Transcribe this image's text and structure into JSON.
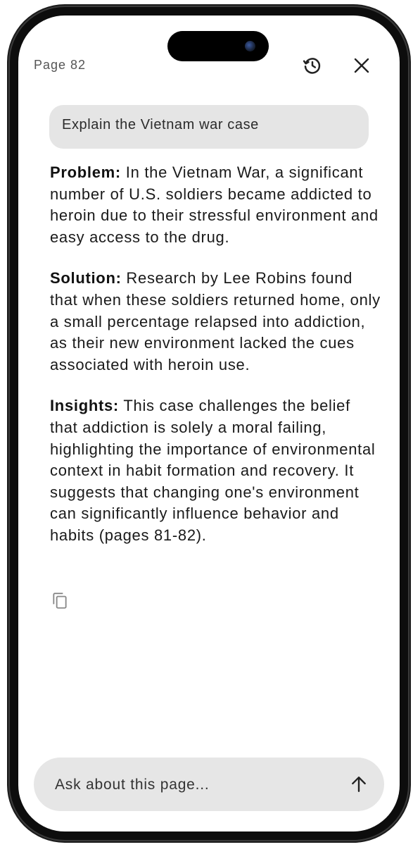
{
  "header": {
    "page_label": "Page 82"
  },
  "conversation": {
    "user_message": "Explain the Vietnam war case",
    "sections": [
      {
        "heading": "Problem:",
        "text": " In the Vietnam War, a significant number of U.S. soldiers became addicted to heroin due to their stressful environment and easy access to the drug."
      },
      {
        "heading": "Solution:",
        "text": " Research by Lee Robins found that when these soldiers returned home, only a small percentage relapsed into addiction, as their new environment lacked the cues associated with heroin use."
      },
      {
        "heading": "Insights:",
        "text": " This case challenges the belief that addiction is solely a moral failing, highlighting the importance of environmental context in habit formation and recovery. It suggests that changing one's environment can significantly influence behavior and habits (pages 81-82)."
      }
    ]
  },
  "composer": {
    "placeholder": "Ask about this page..."
  },
  "icons": {
    "history": "history-icon",
    "close": "close-icon",
    "copy": "copy-icon",
    "send": "arrow-up-icon"
  }
}
